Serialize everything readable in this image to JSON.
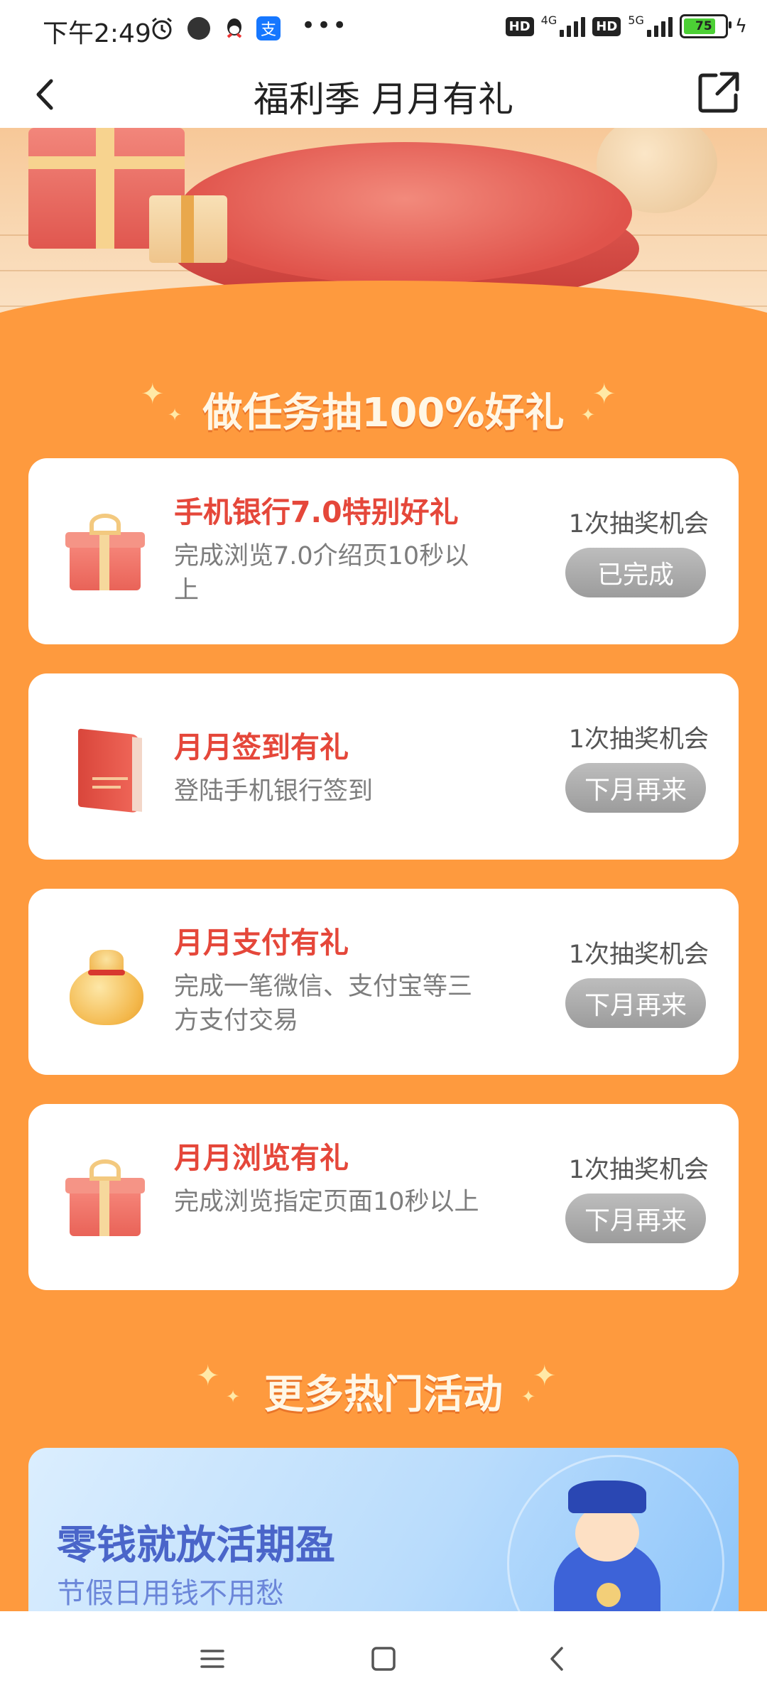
{
  "status_bar": {
    "time": "下午2:49",
    "network_1": "4G",
    "network_2": "5G",
    "hd_label": "HD",
    "battery": "75",
    "icons": [
      "alarm-icon",
      "camera-dot-icon",
      "qq-icon",
      "alipay-icon",
      "more-dots-icon",
      "signal-icon",
      "battery-icon",
      "charging-icon"
    ]
  },
  "nav": {
    "title": "福利季 月月有礼"
  },
  "tasks_section": {
    "title": "做任务抽100%好礼",
    "tasks": [
      {
        "title": "手机银行7.0特别好礼",
        "desc": "完成浏览7.0介绍页10秒以上",
        "chance": "1次抽奖机会",
        "button": "已完成",
        "icon": "gift-box-icon"
      },
      {
        "title": "月月签到有礼",
        "desc": "登陆手机银行签到",
        "chance": "1次抽奖机会",
        "button": "下月再来",
        "icon": "red-book-icon"
      },
      {
        "title": "月月支付有礼",
        "desc": "完成一笔微信、支付宝等三方支付交易",
        "chance": "1次抽奖机会",
        "button": "下月再来",
        "icon": "money-bag-icon"
      },
      {
        "title": "月月浏览有礼",
        "desc": "完成浏览指定页面10秒以上",
        "chance": "1次抽奖机会",
        "button": "下月再来",
        "icon": "gift-box-icon"
      }
    ]
  },
  "more_section": {
    "title": "更多热门活动",
    "banner": {
      "title": "零钱就放活期盈",
      "subtitle": "节假日用钱不用愁"
    }
  },
  "colors": {
    "page_bg": "#fe9a3e",
    "task_title": "#e5473a",
    "button_gray": "#a8a8a8",
    "banner_title": "#4a65c9"
  }
}
